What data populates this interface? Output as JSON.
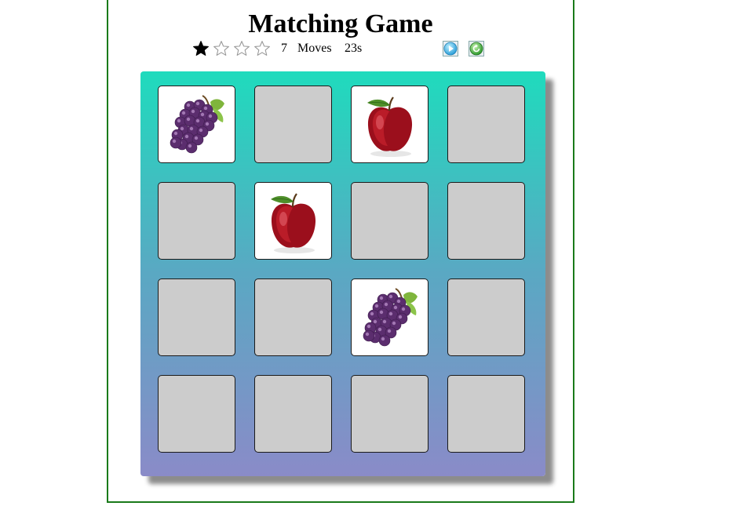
{
  "game": {
    "title": "Matching Game",
    "stars": [
      {
        "filled": true
      },
      {
        "filled": false
      },
      {
        "filled": false
      },
      {
        "filled": false
      }
    ],
    "moves_count": "7",
    "moves_label": "Moves",
    "timer": "23s",
    "controls": [
      {
        "name": "play",
        "icon": "play-icon"
      },
      {
        "name": "restart",
        "icon": "restart-icon"
      }
    ],
    "colors": {
      "deck_top": "#1fdbbd",
      "deck_bottom": "#8a8bc8",
      "card_back": "#cccccc",
      "card_open": "#ffffff",
      "border": "#1a7a1a"
    },
    "cards": [
      {
        "state": "open",
        "fruit": "grapes-icon"
      },
      {
        "state": "closed",
        "fruit": ""
      },
      {
        "state": "open",
        "fruit": "apple-icon"
      },
      {
        "state": "closed",
        "fruit": ""
      },
      {
        "state": "closed",
        "fruit": ""
      },
      {
        "state": "open",
        "fruit": "apple-icon"
      },
      {
        "state": "closed",
        "fruit": ""
      },
      {
        "state": "closed",
        "fruit": ""
      },
      {
        "state": "closed",
        "fruit": ""
      },
      {
        "state": "closed",
        "fruit": ""
      },
      {
        "state": "open",
        "fruit": "grapes-icon"
      },
      {
        "state": "closed",
        "fruit": ""
      },
      {
        "state": "closed",
        "fruit": ""
      },
      {
        "state": "closed",
        "fruit": ""
      },
      {
        "state": "closed",
        "fruit": ""
      },
      {
        "state": "closed",
        "fruit": ""
      }
    ]
  }
}
